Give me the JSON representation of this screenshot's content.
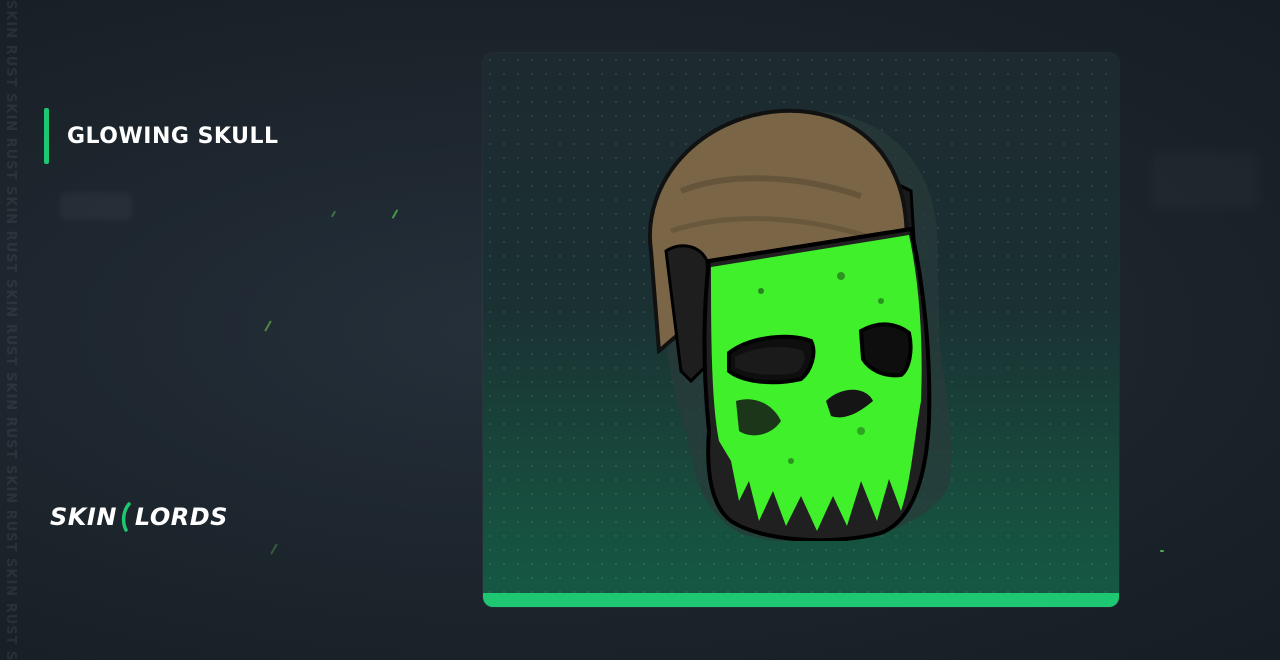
{
  "item": {
    "name": "GLOWING SKULL"
  },
  "brand": {
    "logo_text_left": "SKIN",
    "logo_text_right": "LORDS",
    "watermark_repeat": "SKIN RUST SKIN RUST SKIN RUST SKIN RUST SKIN RUST SKIN RUST SKIN RUST SKIN RUST SKIN RUST"
  },
  "colors": {
    "accent": "#1ec771",
    "background": "#1c242c",
    "mask_green": "#3ff02a"
  },
  "icons": {
    "logo_mark": "green-slash-mark-icon",
    "item": "glowing-skull-mask-icon"
  }
}
